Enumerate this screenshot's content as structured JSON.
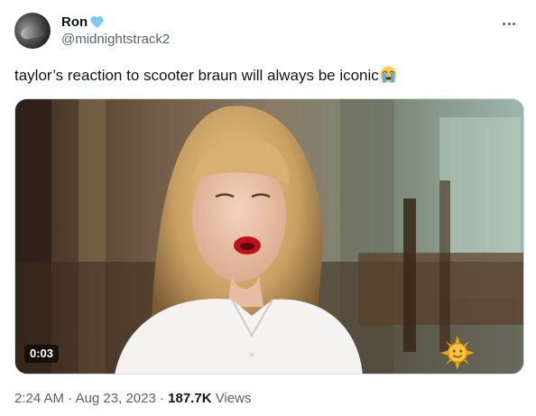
{
  "user": {
    "display_name": "Ron",
    "handle": "@midnightstrack2",
    "badge_icon": "blue-heart-icon",
    "badge_color": "#7ec8f0"
  },
  "tweet": {
    "text": "taylor’s reaction to scooter braun will always be iconic",
    "emoji_icon": "loudly-crying-face-icon"
  },
  "media": {
    "type": "video",
    "duration": "0:03",
    "watermark_icon": "cbs-sunday-morning-sun-icon"
  },
  "meta": {
    "time": "2:24 AM",
    "separator": "·",
    "date": "Aug 23, 2023",
    "views_count": "187.7K",
    "views_label": "Views"
  },
  "colors": {
    "text_primary": "#0f1419",
    "text_secondary": "#536471",
    "border": "#cfd9de"
  }
}
